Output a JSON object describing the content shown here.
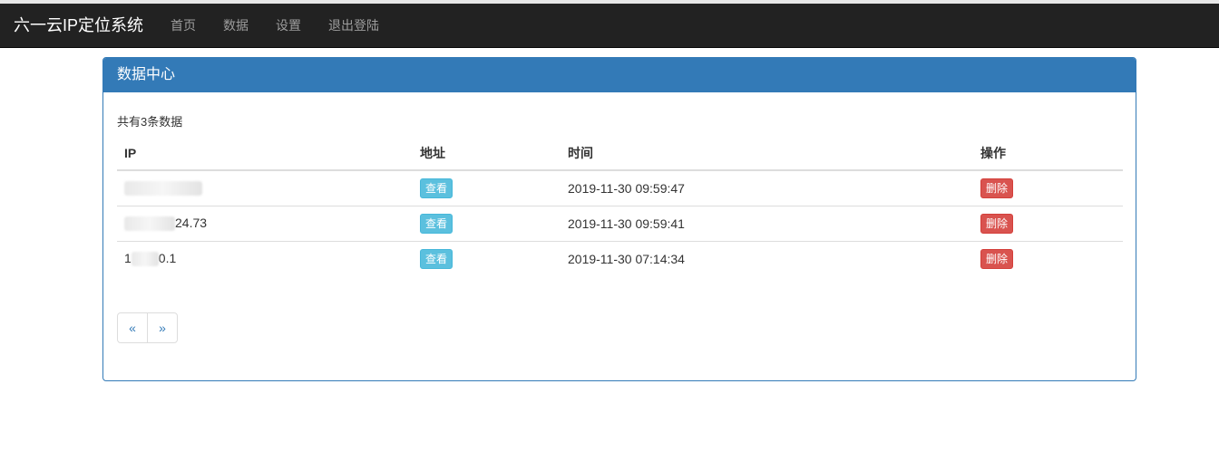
{
  "navbar": {
    "brand": "六一云IP定位系统",
    "items": [
      "首页",
      "数据",
      "设置",
      "退出登陆"
    ]
  },
  "panel": {
    "title": "数据中心",
    "total_text": "共有3条数据",
    "columns": [
      "IP",
      "地址",
      "时间",
      "操作"
    ],
    "rows": [
      {
        "ip_visible": "",
        "view_label": "查看",
        "time": "2019-11-30 09:59:47",
        "delete_label": "删除"
      },
      {
        "ip_visible": "24.73",
        "view_label": "查看",
        "time": "2019-11-30 09:59:41",
        "delete_label": "删除"
      },
      {
        "ip_prefix_visible": "1",
        "ip_visible": "0.1",
        "view_label": "查看",
        "time": "2019-11-30 07:14:34",
        "delete_label": "删除"
      }
    ],
    "pagination": {
      "prev": "«",
      "next": "»"
    }
  },
  "colors": {
    "navbar_bg": "#222222",
    "panel_primary": "#337ab7",
    "btn_info": "#5bc0de",
    "btn_danger": "#d9534f"
  }
}
